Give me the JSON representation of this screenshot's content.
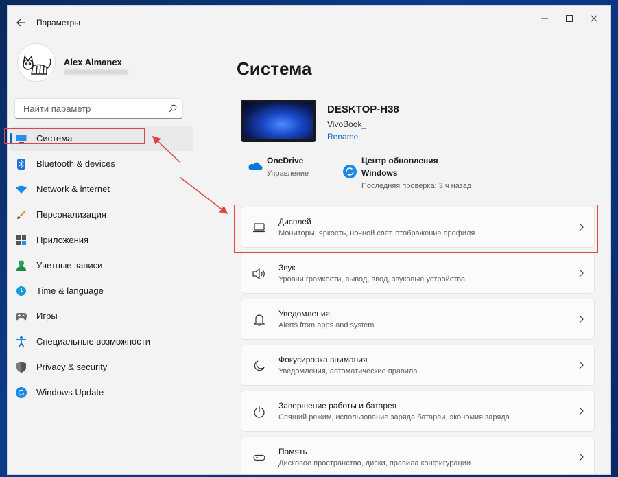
{
  "window": {
    "title": "Параметры"
  },
  "user": {
    "name": "Alex Almanex"
  },
  "search": {
    "placeholder": "Найти параметр"
  },
  "sidebar": {
    "items": [
      {
        "label": "Система",
        "icon": "system-icon",
        "selected": true
      },
      {
        "label": "Bluetooth & devices",
        "icon": "bluetooth-icon"
      },
      {
        "label": "Network & internet",
        "icon": "wifi-icon"
      },
      {
        "label": "Персонализация",
        "icon": "brush-icon"
      },
      {
        "label": "Приложения",
        "icon": "apps-icon"
      },
      {
        "label": "Учетные записи",
        "icon": "person-icon"
      },
      {
        "label": "Time & language",
        "icon": "globe-clock-icon"
      },
      {
        "label": "Игры",
        "icon": "gamepad-icon"
      },
      {
        "label": "Специальные возможности",
        "icon": "accessibility-icon"
      },
      {
        "label": "Privacy & security",
        "icon": "shield-icon"
      },
      {
        "label": "Windows Update",
        "icon": "update-icon"
      }
    ]
  },
  "main": {
    "title": "Система",
    "device": {
      "name": "DESKTOP-H38",
      "model": "VivoBook_",
      "rename": "Rename"
    },
    "onedrive": {
      "title": "OneDrive",
      "subtitle": "Управление"
    },
    "update": {
      "title_line1": "Центр обновления",
      "title_line2": "Windows",
      "subtitle": "Последняя проверка: 3 ч назад"
    },
    "cards": [
      {
        "title": "Дисплей",
        "subtitle": "Мониторы, яркость, ночной свет, отображение профиля",
        "icon": "monitor-icon"
      },
      {
        "title": "Звук",
        "subtitle": "Уровни громкости, вывод, ввод, звуковые устройства",
        "icon": "speaker-icon"
      },
      {
        "title": "Уведомления",
        "subtitle": "Alerts from apps and system",
        "icon": "bell-icon"
      },
      {
        "title": "Фокусировка внимания",
        "subtitle": "Уведомления, автоматические правила",
        "icon": "moon-icon"
      },
      {
        "title": "Завершение работы и батарея",
        "subtitle": "Спящий режим, использование заряда батареи, экономия заряда",
        "icon": "power-icon"
      },
      {
        "title": "Память",
        "subtitle": "Дисковое пространство, диски, правила конфигурации",
        "icon": "storage-icon"
      }
    ]
  },
  "colors": {
    "accent": "#0067c0",
    "annotation": "#e04646"
  }
}
